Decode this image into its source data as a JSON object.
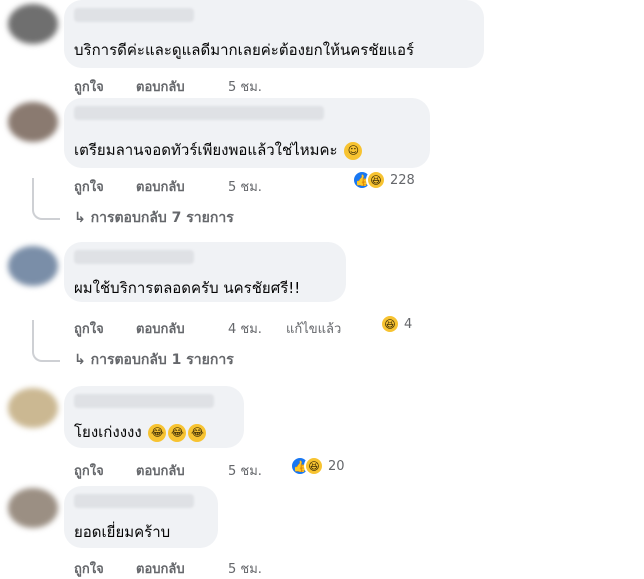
{
  "actions": {
    "like": "ถูกใจ",
    "reply": "ตอบกลับ",
    "edited": "แก้ไขแล้ว"
  },
  "reaction_icons": {
    "like": "thumbs-up-icon",
    "haha": "laughing-face-icon",
    "smile": "smiling-face-icon",
    "tears": "tears-of-joy-icon"
  },
  "colors": {
    "bubble": "#f0f2f5",
    "like_blue": "#1877f2",
    "haha_yellow": "#f7c331",
    "muted": "#65676b"
  },
  "comments": [
    {
      "text": "บริการดีค่ะและดูแลดีมากเลยค่ะต้องยกให้นครชัยแอร์",
      "time": "5 ชม."
    },
    {
      "text": "เตรียมลานจอดทัวร์เพียงพอแล้วใช่ไหมคะ",
      "time": "5 ชม.",
      "reaction_count": "228",
      "replies": "↳ การตอบกลับ 7 รายการ"
    },
    {
      "text": "ผมใช้บริการตลอดครับ นครชัยศรี!!",
      "time": "4 ชม.",
      "reaction_count": "4",
      "replies": "↳ การตอบกลับ 1 รายการ"
    },
    {
      "text": "โยงเก่งงงง",
      "time": "5 ชม.",
      "reaction_count": "20"
    },
    {
      "text": "ยอดเยี่ยมคร้าบ",
      "time": "5 ชม."
    }
  ]
}
